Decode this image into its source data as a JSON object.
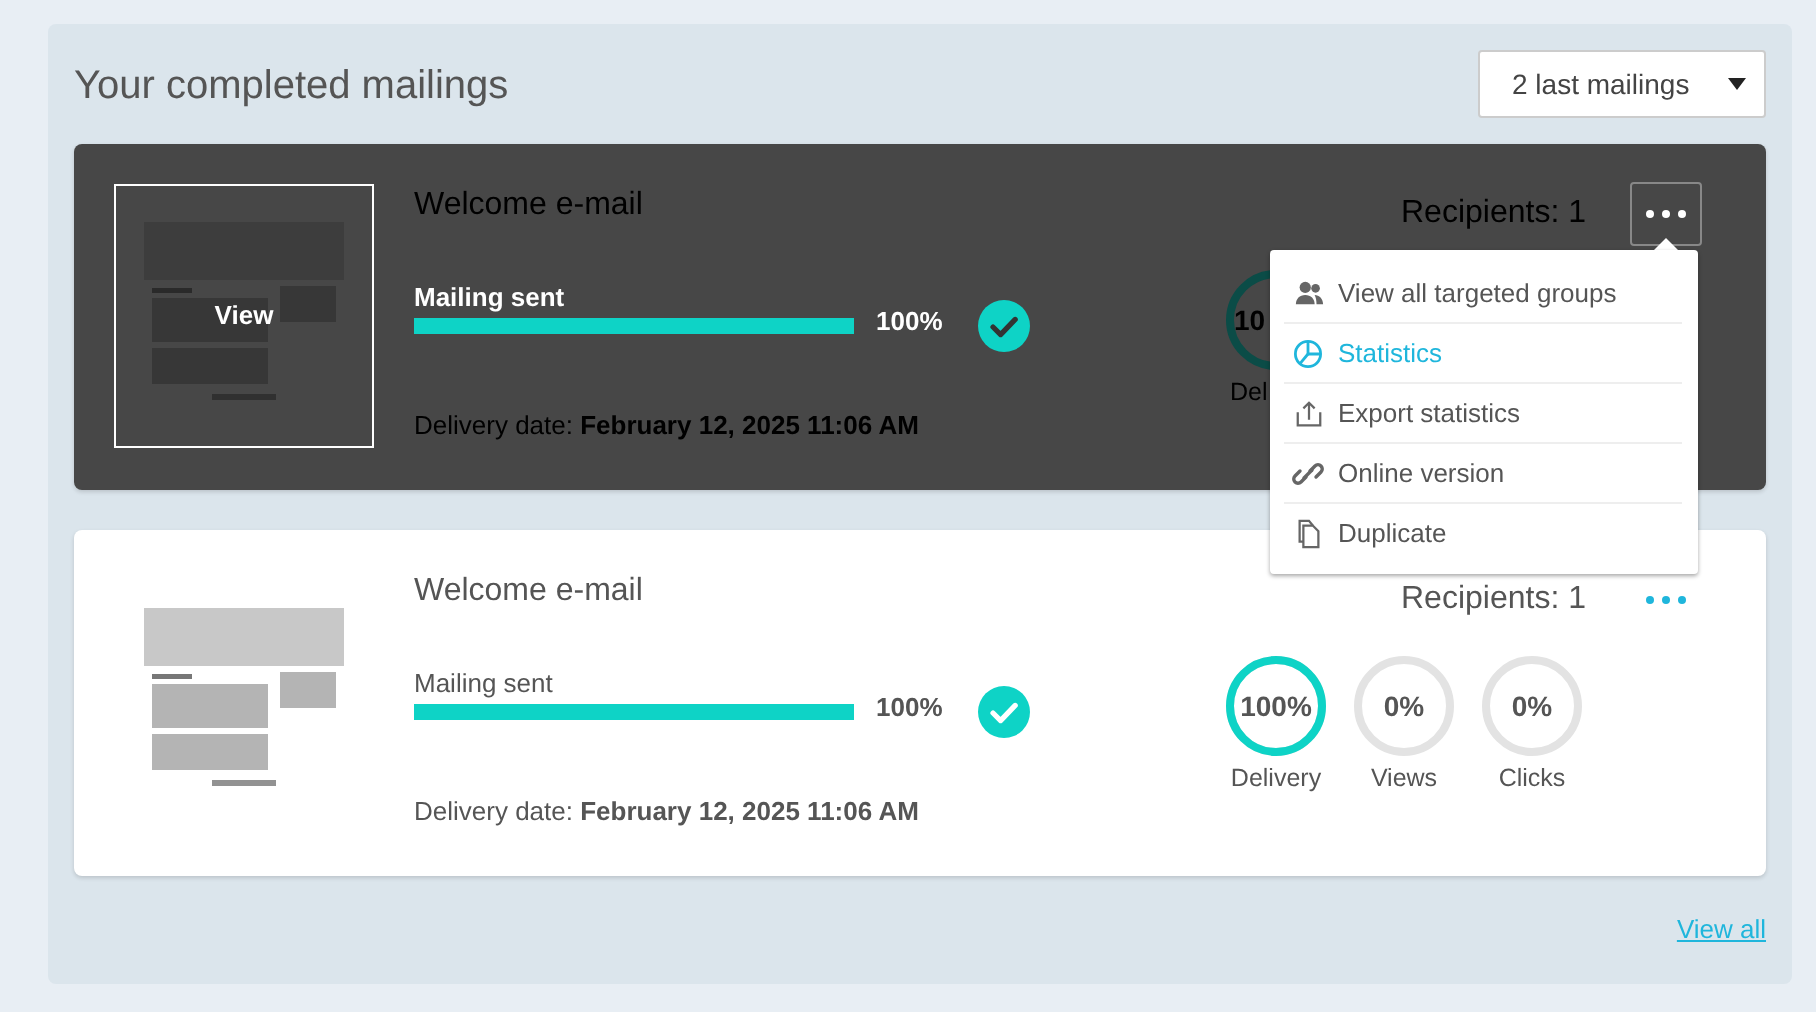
{
  "title": "Your completed mailings",
  "filter": {
    "value": "2 last mailings"
  },
  "mailings": [
    {
      "hovered": true,
      "menu_open": true,
      "thumbnail_label": "View",
      "name": "Welcome e-mail",
      "progress": {
        "label": "Mailing sent",
        "level": 1,
        "reading": "100%",
        "done": true
      },
      "delivery": "Delivery date: **February 12, 2025 11:06 AM**",
      "recipients": "Recipients: 1",
      "stats": [
        {
          "value": "10",
          "label": "Del"
        }
      ]
    },
    {
      "hovered": false,
      "menu_open": false,
      "name": "Welcome e-mail",
      "progress": {
        "label": "Mailing sent",
        "level": 1,
        "reading": "100%",
        "done": true
      },
      "delivery": "Delivery date: **February 12, 2025 11:06 AM**",
      "recipients": "Recipients: 1",
      "stats": [
        {
          "value": "100%",
          "label": "Delivery",
          "level": 1
        },
        {
          "value": "0%",
          "label": "Views",
          "level": 0
        },
        {
          "value": "0%",
          "label": "Clicks",
          "level": 0
        }
      ]
    }
  ],
  "menu": {
    "items": [
      {
        "kind": "groups",
        "label": "View all targeted groups",
        "selected": false
      },
      {
        "kind": "statistics",
        "label": "Statistics",
        "selected": true
      },
      {
        "kind": "export",
        "label": "Export statistics",
        "selected": false
      },
      {
        "kind": "online",
        "label": "Online version",
        "selected": false
      },
      {
        "kind": "duplicate",
        "label": "Duplicate",
        "selected": false
      }
    ]
  },
  "view_all": "View all"
}
